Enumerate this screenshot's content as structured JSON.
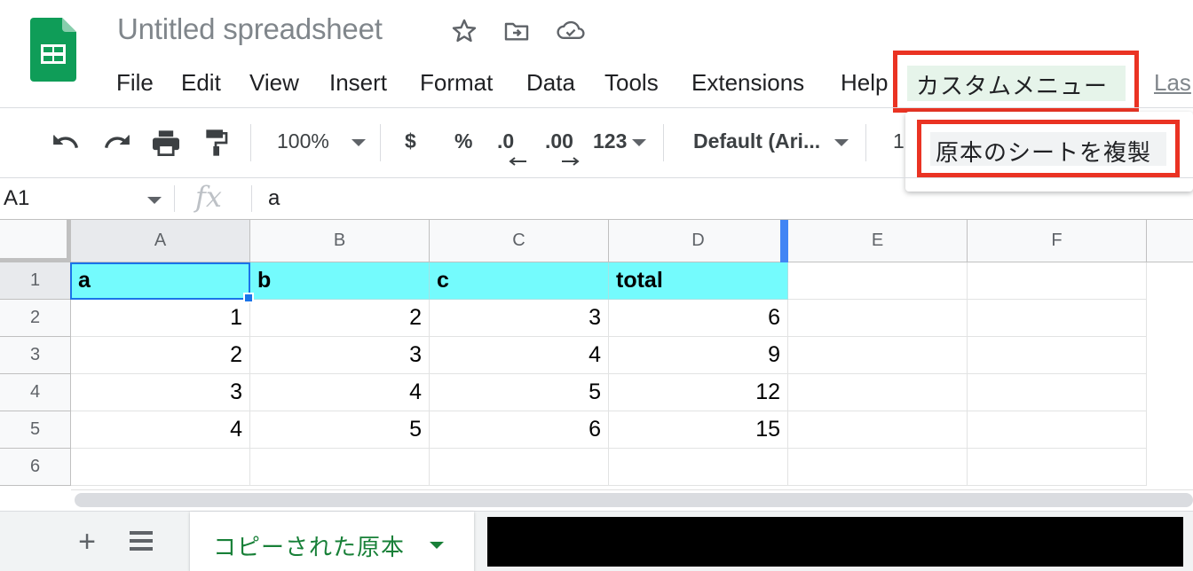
{
  "header": {
    "title": "Untitled spreadsheet",
    "last_edit": "Las"
  },
  "menubar": {
    "items": [
      "File",
      "Edit",
      "View",
      "Insert",
      "Format",
      "Data",
      "Tools",
      "Extensions",
      "Help"
    ],
    "custom_menu": "カスタムメニュー"
  },
  "dropdown": {
    "item": "原本のシートを複製"
  },
  "toolbar": {
    "zoom": "100%",
    "currency": "$",
    "percent": "%",
    "decrease_decimal": ".0",
    "increase_decimal": ".00",
    "more_formats": "123",
    "font": "Default (Ari...",
    "font_size": "1"
  },
  "formula_bar": {
    "name_box": "A1",
    "fx": "fx",
    "value": "a"
  },
  "grid": {
    "columns": [
      "A",
      "B",
      "C",
      "D",
      "E",
      "F"
    ],
    "rows": [
      "1",
      "2",
      "3",
      "4",
      "5",
      "6"
    ],
    "cells": [
      [
        "a",
        "b",
        "c",
        "total"
      ],
      [
        "1",
        "2",
        "3",
        "6"
      ],
      [
        "2",
        "3",
        "4",
        "9"
      ],
      [
        "3",
        "4",
        "5",
        "12"
      ],
      [
        "4",
        "5",
        "6",
        "15"
      ]
    ],
    "header_fill": "#74fbfd",
    "selection_color": "#1a73e8"
  },
  "sheets": {
    "add_label": "+",
    "active_tab": "コピーされた原本"
  },
  "colors": {
    "highlight_border": "#ea3323",
    "brand_green": "#0f9d58",
    "tab_text": "#188038"
  }
}
